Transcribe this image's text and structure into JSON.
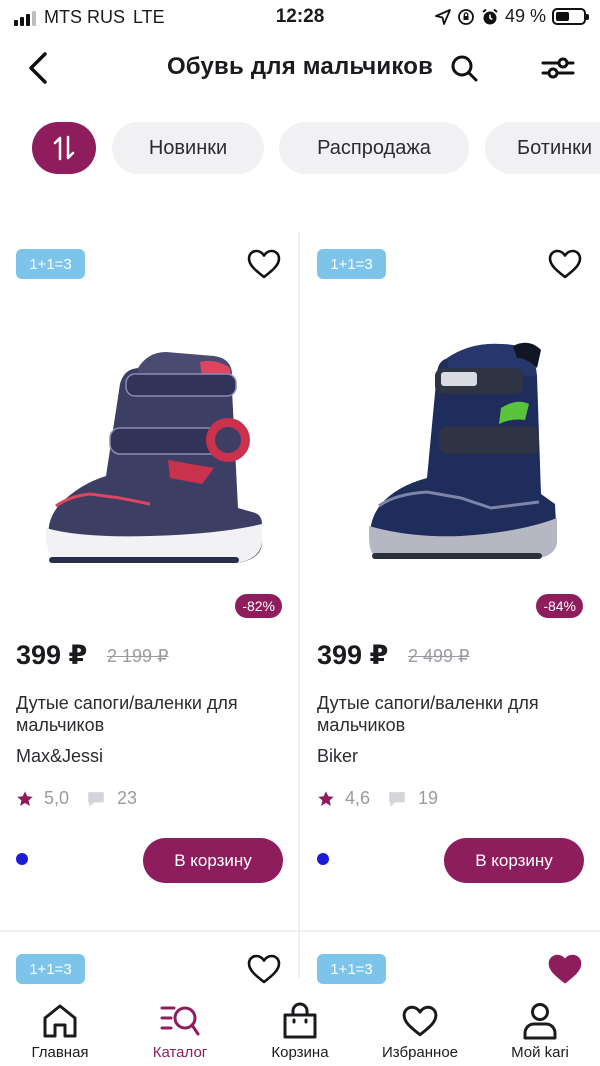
{
  "status_bar": {
    "carrier": "MTS RUS",
    "network": "LTE",
    "time": "12:28",
    "battery": "49 %",
    "battery_level": 0.49
  },
  "header": {
    "title": "Обувь для мальчиков"
  },
  "chips": [
    {
      "label": "Новинки"
    },
    {
      "label": "Распродажа"
    },
    {
      "label": "Ботинки"
    }
  ],
  "products": [
    {
      "promo": "1+1=3",
      "discount": "-82%",
      "price": "399 ₽",
      "old_price": "2 199 ₽",
      "name": "Дутые сапоги/валенки для мальчиков",
      "brand": "Max&Jessi",
      "rating": "5,0",
      "reviews": "23",
      "color": "#1c1cd8",
      "cart_label": "В корзину",
      "favorite": false
    },
    {
      "promo": "1+1=3",
      "discount": "-84%",
      "price": "399 ₽",
      "old_price": "2 499 ₽",
      "name": "Дутые сапоги/валенки для мальчиков",
      "brand": "Biker",
      "rating": "4,6",
      "reviews": "19",
      "color": "#1c1cd8",
      "cart_label": "В корзину",
      "favorite": false
    }
  ],
  "next_row": [
    {
      "promo": "1+1=3",
      "favorite": false
    },
    {
      "promo": "1+1=3",
      "favorite": true
    }
  ],
  "bottom_nav": [
    {
      "label": "Главная",
      "icon": "home-icon"
    },
    {
      "label": "Каталог",
      "icon": "catalog-search-icon",
      "active": true
    },
    {
      "label": "Корзина",
      "icon": "bag-icon"
    },
    {
      "label": "Избранное",
      "icon": "heart-icon"
    },
    {
      "label": "Мой kari",
      "icon": "user-icon"
    }
  ],
  "colors": {
    "accent": "#8e1d5e",
    "promo_badge": "#7cc4ea",
    "chip_bg": "#f1f1f3"
  }
}
